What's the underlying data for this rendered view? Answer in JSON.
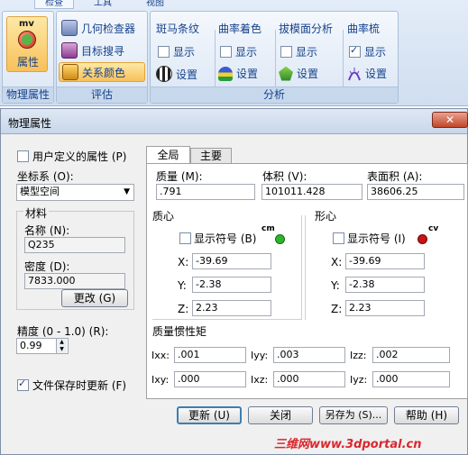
{
  "ribbon": {
    "tabs": [
      "",
      "检查",
      "工具",
      "视图"
    ],
    "mass_props": {
      "badge": "mv",
      "label": "属性",
      "group_label": "物理属性"
    },
    "evaluate": {
      "items": [
        "几何检查器",
        "目标搜寻",
        "关系颜色"
      ],
      "group_label": "评估"
    },
    "analysis": {
      "group_label": "分析",
      "sections": [
        {
          "title": "斑马条纹",
          "show": "显示",
          "settings": "设置",
          "checked": false
        },
        {
          "title": "曲率着色",
          "show": "显示",
          "settings": "设置",
          "checked": false
        },
        {
          "title": "拔模面分析",
          "show": "显示",
          "settings": "设置",
          "checked": false
        },
        {
          "title": "曲率梳",
          "show": "显示",
          "settings": "设置",
          "checked": true
        }
      ]
    }
  },
  "dialog": {
    "title": "物理属性",
    "user_defined": "用户定义的属性 (P)",
    "coord_label": "坐标系 (O):",
    "coord_value": "模型空间",
    "material_group": "材料",
    "name_label": "名称 (N):",
    "name_value": "Q235",
    "density_label": "密度 (D):",
    "density_value": "7833.000",
    "change_btn": "更改 (G)",
    "precision_label": "精度 (0 - 1.0) (R):",
    "precision_value": "0.99",
    "update_on_save": "文件保存时更新 (F)",
    "tabs": [
      "全局",
      "主要"
    ],
    "mass_label": "质量 (M):",
    "mass_value": ".791",
    "volume_label": "体积 (V):",
    "volume_value": "101011.428",
    "area_label": "表面积 (A):",
    "area_value": "38606.25",
    "cog": {
      "title": "质心",
      "show": "显示符号 (B)",
      "symbol": "cm",
      "x_label": "X:",
      "y_label": "Y:",
      "z_label": "Z:",
      "x": "-39.69",
      "y": "-2.38",
      "z": "2.23"
    },
    "coc": {
      "title": "形心",
      "show": "显示符号 (I)",
      "symbol": "cv",
      "x_label": "X:",
      "y_label": "Y:",
      "z_label": "Z:",
      "x": "-39.69",
      "y": "-2.38",
      "z": "2.23"
    },
    "inertia": {
      "title": "质量惯性矩",
      "row1": [
        {
          "label": "Ixx:",
          "value": ".001"
        },
        {
          "label": "Iyy:",
          "value": ".003"
        },
        {
          "label": "Izz:",
          "value": ".002"
        }
      ],
      "row2": [
        {
          "label": "Ixy:",
          "value": ".000"
        },
        {
          "label": "Ixz:",
          "value": ".000"
        },
        {
          "label": "Iyz:",
          "value": ".000"
        }
      ]
    },
    "buttons": {
      "update": "更新 (U)",
      "close": "关闭",
      "save_as": "另存为 (S)...",
      "help": "帮助 (H)"
    }
  },
  "watermark": "三维网www.3dportal.cn",
  "colors": {
    "cog_marker": "#2bb52b",
    "coc_marker": "#c81414",
    "accent": "#15428b"
  }
}
